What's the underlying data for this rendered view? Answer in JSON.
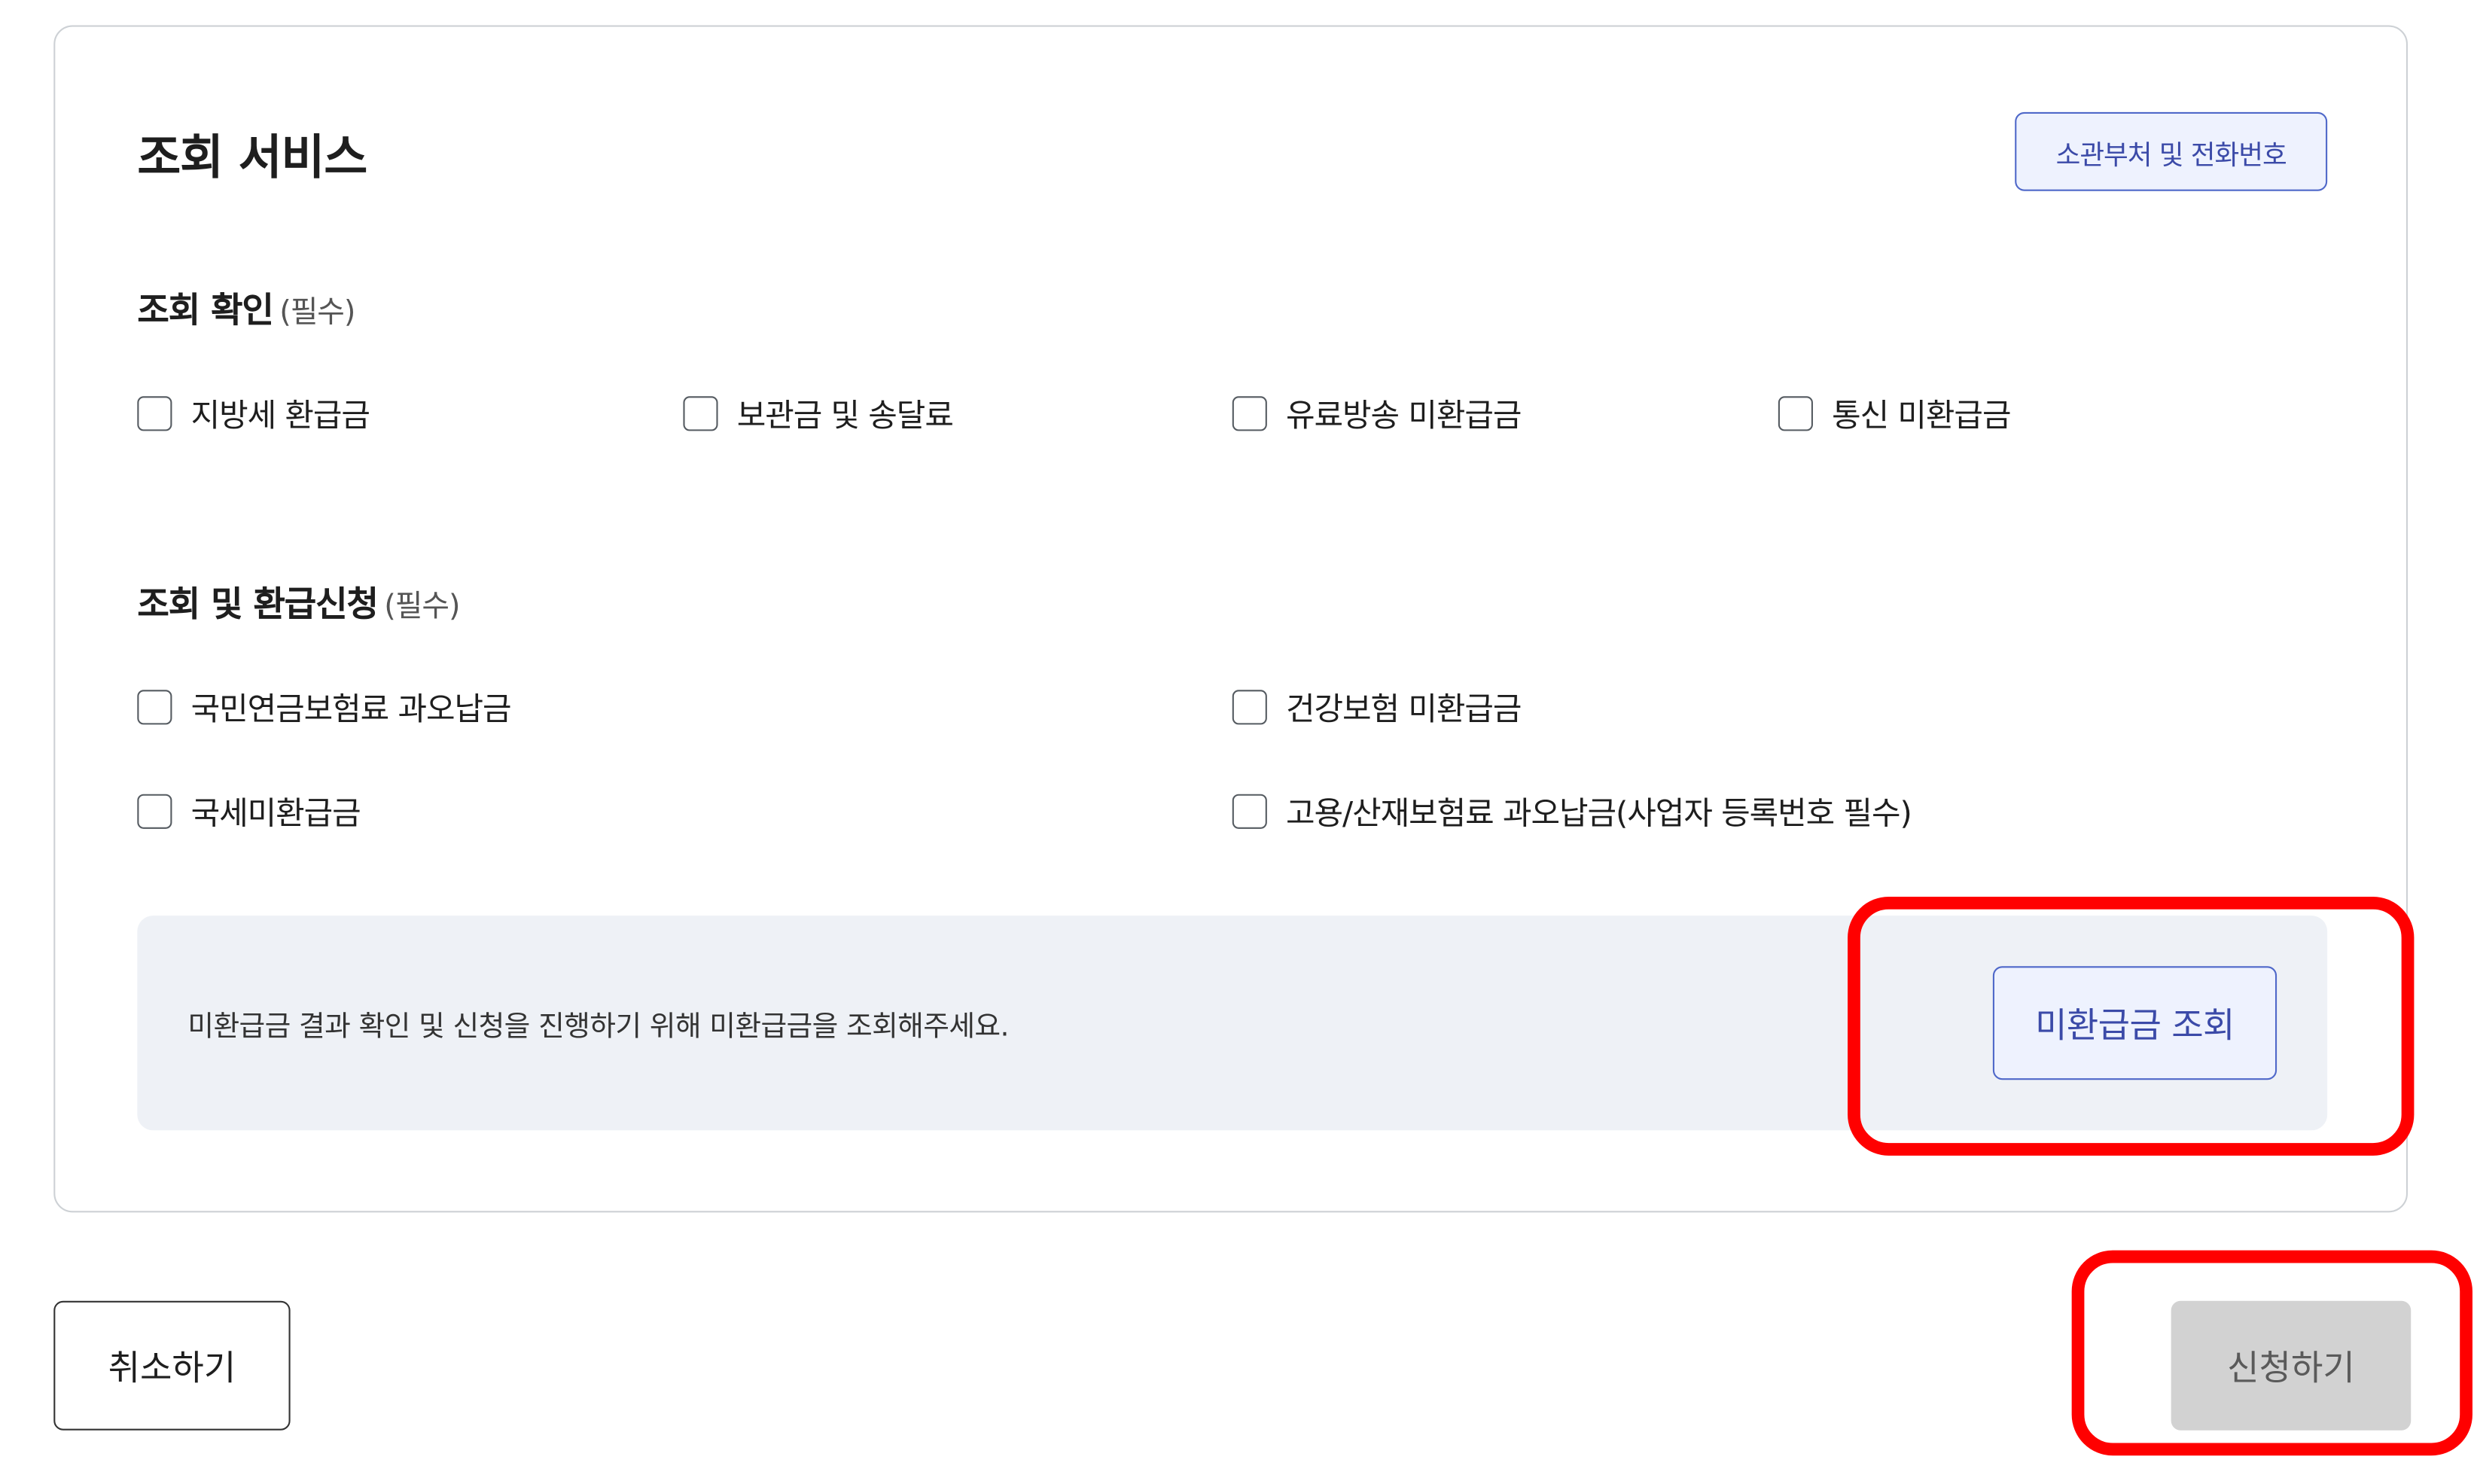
{
  "card": {
    "title": "조회 서비스",
    "dept_button_label": "소관부처 및 전화번호"
  },
  "section_inquiry": {
    "title": "조회 확인",
    "required_note": "(필수)",
    "options": [
      {
        "label": "지방세 환급금",
        "checked": false
      },
      {
        "label": "보관금 및 송달료",
        "checked": false
      },
      {
        "label": "유료방송 미환급금",
        "checked": false
      },
      {
        "label": "통신 미환급금",
        "checked": false
      }
    ]
  },
  "section_refund": {
    "title": "조회 및 환급신청",
    "required_note": "(필수)",
    "options": [
      {
        "label": "국민연금보험료 과오납금",
        "checked": false
      },
      {
        "label": "건강보험 미환급금",
        "checked": false
      },
      {
        "label": "국세미환급금",
        "checked": false
      },
      {
        "label": "고용/산재보험료 과오납금(사업자 등록번호 필수)",
        "checked": false
      }
    ]
  },
  "notice": {
    "text": "미환급금 결과 확인 및 신청을 진행하기 위해 미환급금을 조회해주세요.",
    "lookup_button_label": "미환급금 조회"
  },
  "footer": {
    "cancel_label": "취소하기",
    "apply_label": "신청하기",
    "apply_disabled": true
  },
  "colors": {
    "accent_border": "#4f68c9",
    "accent_bg": "#eef2fe",
    "highlight": "#ff0000",
    "notice_bg": "#eef1f6",
    "disabled_bg": "#d2d2d2"
  }
}
